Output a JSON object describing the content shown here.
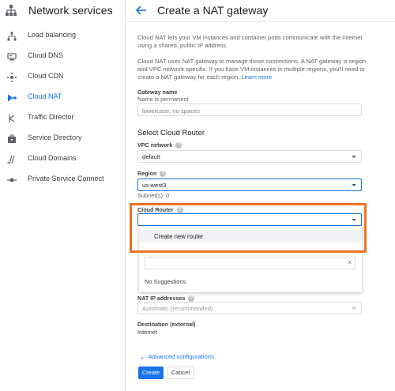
{
  "sidebar": {
    "title": "Network services",
    "icon": "network-services-icon",
    "items": [
      {
        "label": "Load balancing",
        "icon": "load-balancing-icon"
      },
      {
        "label": "Cloud DNS",
        "icon": "cloud-dns-icon"
      },
      {
        "label": "Cloud CDN",
        "icon": "cloud-cdn-icon"
      },
      {
        "label": "Cloud NAT",
        "icon": "cloud-nat-icon",
        "active": true
      },
      {
        "label": "Traffic Director",
        "icon": "traffic-director-icon"
      },
      {
        "label": "Service Directory",
        "icon": "service-directory-icon"
      },
      {
        "label": "Cloud Domains",
        "icon": "cloud-domains-icon"
      },
      {
        "label": "Private Service Connect",
        "icon": "private-service-connect-icon"
      }
    ]
  },
  "header": {
    "title": "Create a NAT gateway",
    "back_icon": "back-arrow-icon"
  },
  "intro": {
    "p1": "Cloud NAT lets your VM instances and container pods communicate with the internet using a shared, public IP address.",
    "p2": "Cloud NAT uses NAT gateway to manage those connections. A NAT gateway is region and VPC network specific. If you have VM instances in multiple regions, you'll need to create a NAT gateway for each region.",
    "learn_more": "Learn more"
  },
  "gateway": {
    "label": "Gateway name",
    "hint": "Name is permanent",
    "placeholder": "lowercase, no spaces"
  },
  "router_section": {
    "heading": "Select Cloud Router",
    "vpc_label": "VPC network",
    "vpc_value": "default",
    "region_label": "Region",
    "region_value": "us-west3",
    "subnets": "Subnet(s): 0",
    "router_label": "Cloud Router",
    "router_value": ""
  },
  "dropdown": {
    "option": "Create new router",
    "search_value": "",
    "clear_icon": "×",
    "no_suggestions": "No Suggestions"
  },
  "nat_ip": {
    "label": "NAT IP addresses",
    "value": "Automatic (recommended)"
  },
  "destination": {
    "label": "Destination (external)",
    "value": "Internet"
  },
  "advanced": "Advanced configurations",
  "buttons": {
    "create": "Create",
    "cancel": "Cancel"
  },
  "colors": {
    "accent": "#1a73e8",
    "highlight": "#ee7424"
  }
}
